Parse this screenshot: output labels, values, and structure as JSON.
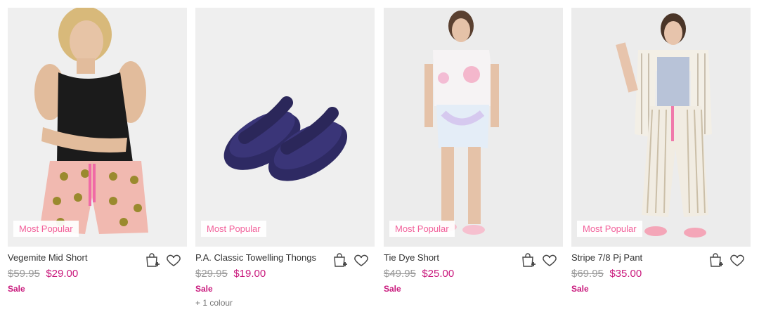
{
  "products": [
    {
      "name": "Vegemite Mid Short",
      "badge": "Most Popular",
      "was_price": "$59.95",
      "price": "$29.00",
      "status": "Sale",
      "colours": "",
      "image_alt": "model wearing black tank and vegemite print shorts"
    },
    {
      "name": "P.A. Classic Towelling Thongs",
      "badge": "Most Popular",
      "was_price": "$29.95",
      "price": "$19.00",
      "status": "Sale",
      "colours": "+ 1 colour",
      "image_alt": "navy towelling thongs"
    },
    {
      "name": "Tie Dye Short",
      "badge": "Most Popular",
      "was_price": "$49.95",
      "price": "$25.00",
      "status": "Sale",
      "colours": "",
      "image_alt": "model wearing tie dye pyjama short set"
    },
    {
      "name": "Stripe 7/8 Pj Pant",
      "badge": "Most Popular",
      "was_price": "$69.95",
      "price": "$35.00",
      "status": "Sale",
      "colours": "",
      "image_alt": "model wearing striped pyjama pants"
    }
  ],
  "icons": {
    "add_to_bag": "bag-plus-icon",
    "wishlist": "heart-icon"
  },
  "colors": {
    "accent": "#c9187c",
    "badge_text": "#f2619b",
    "muted": "#999999"
  }
}
